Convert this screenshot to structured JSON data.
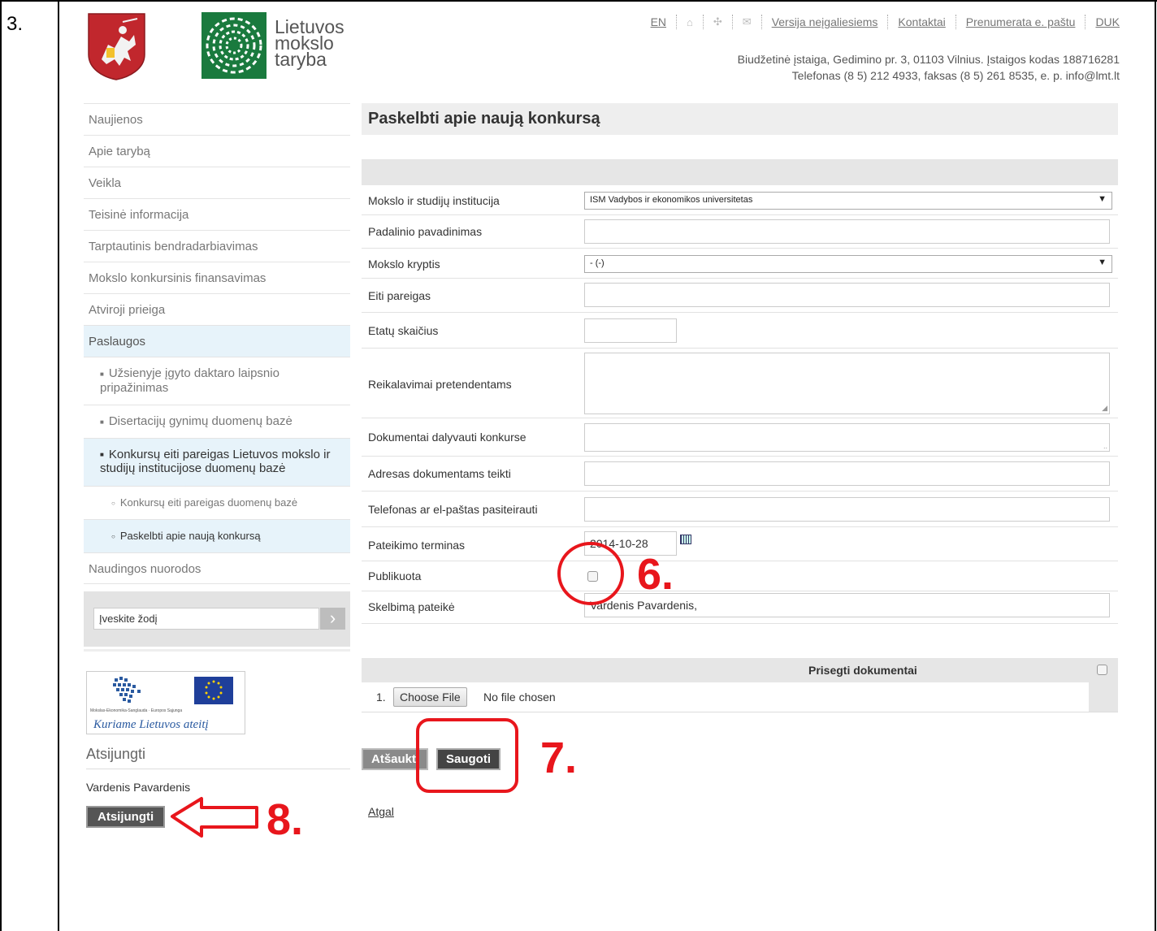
{
  "document": {
    "step_number": "3."
  },
  "header": {
    "logo_text": [
      "Lietuvos",
      "mokslo",
      "taryba"
    ],
    "topnav": [
      {
        "label": "EN"
      },
      {
        "icon": "home-icon"
      },
      {
        "icon": "sitemap-icon"
      },
      {
        "icon": "mail-icon"
      },
      {
        "label": "Versija neįgaliesiems"
      },
      {
        "label": "Kontaktai"
      },
      {
        "label": "Prenumerata e. paštu"
      },
      {
        "label": "DUK"
      }
    ],
    "address_line1": "Biudžetinė įstaiga, Gedimino pr. 3, 01103 Vilnius. Įstaigos kodas 188716281",
    "address_line2": "Telefonas (8 5) 212 4933, faksas (8 5) 261 8535, e. p. info@lmt.lt"
  },
  "sidebar": {
    "items": [
      {
        "label": "Naujienos"
      },
      {
        "label": "Apie tarybą"
      },
      {
        "label": "Veikla"
      },
      {
        "label": "Teisinė informacija"
      },
      {
        "label": "Tarptautinis bendradarbiavimas"
      },
      {
        "label": "Mokslo konkursinis finansavimas"
      },
      {
        "label": "Atviroji prieiga"
      },
      {
        "label": "Paslaugos"
      },
      {
        "label": "Užsienyje įgyto daktaro laipsnio pripažinimas"
      },
      {
        "label": "Disertacijų gynimų duomenų bazė"
      },
      {
        "label": "Konkursų eiti pareigas Lietuvos mokslo ir studijų institucijose duomenų bazė"
      },
      {
        "label": "Konkursų eiti pareigas duomenų bazė"
      },
      {
        "label": "Paskelbti apie naują konkursą"
      },
      {
        "label": "Naudingos nuorodos"
      }
    ],
    "search_value": "Įveskite žodį",
    "search_arrow": "›",
    "banner_caption": "Kuriame Lietuvos ateitį",
    "banner_sub": "Mokslas-Ekonomika-Sanglauda · Europos Sąjunga",
    "logout_title": "Atsijungti",
    "user_name": "Vardenis Pavardenis",
    "logout_button": "Atsijungti"
  },
  "main": {
    "title": "Paskelbti apie naują konkursą",
    "fields": {
      "institution_label": "Mokslo ir studijų institucija",
      "institution_value": "ISM Vadybos ir ekonomikos universitetas",
      "unit_label": "Padalinio pavadinimas",
      "field_label": "Mokslo kryptis",
      "field_value": "- (-)",
      "position_label": "Eiti pareigas",
      "fte_label": "Etatų skaičius",
      "requirements_label": "Reikalavimai pretendentams",
      "documents_label": "Dokumentai dalyvauti konkurse",
      "address_label": "Adresas dokumentams teikti",
      "contact_label": "Telefonas ar el-paštas pasiteirauti",
      "deadline_label": "Pateikimo terminas",
      "deadline_value": "2014-10-28",
      "published_label": "Publikuota",
      "submitter_label": "Skelbimą pateikė",
      "submitter_value": "Vardenis Pavardenis,"
    },
    "attachments": {
      "title": "Prisegti dokumentai",
      "row_number": "1.",
      "choose_file": "Choose File",
      "no_file": "No file chosen"
    },
    "cancel_button": "Atšaukti",
    "save_button": "Saugoti",
    "back_link": "Atgal"
  },
  "annotations": {
    "step6": "6.",
    "step7": "7.",
    "step8": "8.",
    "color": "#e8161c"
  }
}
